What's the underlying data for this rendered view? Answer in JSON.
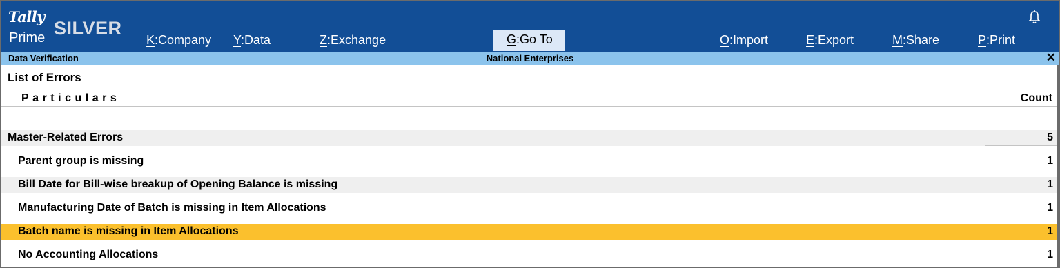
{
  "app": {
    "logo_top": "Tally",
    "logo_bottom": "Prime",
    "edition": "SILVER"
  },
  "menu": [
    {
      "key": "K",
      "label": "Company"
    },
    {
      "key": "Y",
      "label": "Data"
    },
    {
      "key": "Z",
      "label": "Exchange"
    },
    {
      "key": "G",
      "label": "Go To"
    },
    {
      "key": "O",
      "label": "Import"
    },
    {
      "key": "E",
      "label": "Export"
    },
    {
      "key": "M",
      "label": "Share"
    },
    {
      "key": "P",
      "label": "Print"
    }
  ],
  "icons": {
    "bell": "bell-icon",
    "close": "close-icon"
  },
  "subheader": {
    "screen": "Data Verification",
    "company": "National Enterprises",
    "close": "✕"
  },
  "report": {
    "title": "List of Errors",
    "col_particulars": "Particulars",
    "col_count": "Count",
    "group": {
      "label": "Master-Related Errors",
      "count": "5"
    },
    "rows": [
      {
        "label": "Parent group is missing",
        "count": "1"
      },
      {
        "label": "Bill Date for Bill-wise breakup of Opening Balance is missing",
        "count": "1"
      },
      {
        "label": "Manufacturing Date of Batch is missing in Item Allocations",
        "count": "1"
      },
      {
        "label": "Batch name is missing in Item Allocations",
        "count": "1"
      },
      {
        "label": "No Accounting Allocations",
        "count": "1"
      }
    ],
    "selected_row": "Batch name is missing in Item Allocations"
  },
  "colors": {
    "topbar": "#124e96",
    "subbar": "#8bc3ec",
    "selected": "#fbc02d",
    "active_menu": "#dce8f7"
  }
}
